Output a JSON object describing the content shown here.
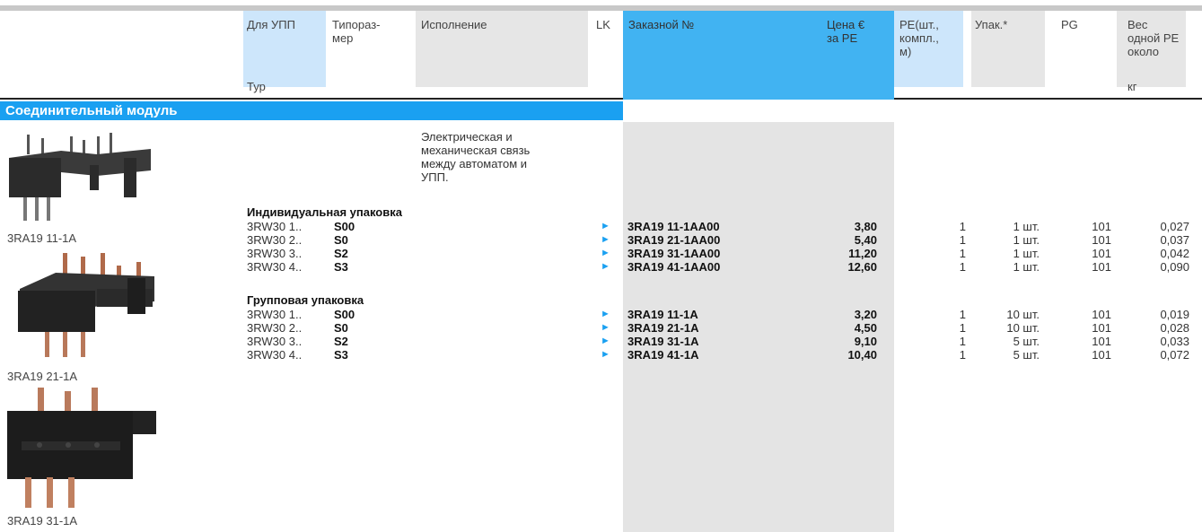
{
  "headers": {
    "dlya_upp": "Для УПП",
    "typ": "Тур",
    "tiporazmer_1": "Типораз-",
    "tiporazmer_2": "мер",
    "ispolnenie": "Исполнение",
    "lk": "LK",
    "order_no": "Заказной №",
    "price_1": "Цена €",
    "price_2": "за PE",
    "pe_1": "PE(шт.,",
    "pe_2": "компл.,",
    "pe_3": "м)",
    "upak": "Упак.*",
    "pg": "PG",
    "weight_1": "Вес",
    "weight_2": "одной PE",
    "weight_3": "около",
    "weight_unit": "кг"
  },
  "section_title": "Соединительный модуль",
  "description": [
    "Электрическая и",
    "механическая связь",
    "между автоматом и",
    "УПП."
  ],
  "group_individual": "Индивидуальная упаковка",
  "group_bulk": "Групповая упаковка",
  "rows_individual": [
    {
      "type": "3RW30 1..",
      "size": "S00",
      "lk": "►",
      "order": "3RA19 11-1AA00",
      "price": "3,80",
      "pe": "1",
      "pack": "1 шт.",
      "pg": "101",
      "weight": "0,027"
    },
    {
      "type": "3RW30 2..",
      "size": "S0",
      "lk": "►",
      "order": "3RA19 21-1AA00",
      "price": "5,40",
      "pe": "1",
      "pack": "1 шт.",
      "pg": "101",
      "weight": "0,037"
    },
    {
      "type": "3RW30 3..",
      "size": "S2",
      "lk": "►",
      "order": "3RA19 31-1AA00",
      "price": "11,20",
      "pe": "1",
      "pack": "1 шт.",
      "pg": "101",
      "weight": "0,042"
    },
    {
      "type": "3RW30 4..",
      "size": "S3",
      "lk": "►",
      "order": "3RA19 41-1AA00",
      "price": "12,60",
      "pe": "1",
      "pack": "1 шт.",
      "pg": "101",
      "weight": "0,090"
    }
  ],
  "rows_bulk": [
    {
      "type": "3RW30 1..",
      "size": "S00",
      "lk": "►",
      "order": "3RA19 11-1A",
      "price": "3,20",
      "pe": "1",
      "pack": "10 шт.",
      "pg": "101",
      "weight": "0,019"
    },
    {
      "type": "3RW30 2..",
      "size": "S0",
      "lk": "►",
      "order": "3RA19 21-1A",
      "price": "4,50",
      "pe": "1",
      "pack": "10 шт.",
      "pg": "101",
      "weight": "0,028"
    },
    {
      "type": "3RW30 3..",
      "size": "S2",
      "lk": "►",
      "order": "3RA19 31-1A",
      "price": "9,10",
      "pe": "1",
      "pack": "5 шт.",
      "pg": "101",
      "weight": "0,033"
    },
    {
      "type": "3RW30 4..",
      "size": "S3",
      "lk": "►",
      "order": "3RA19 41-1A",
      "price": "10,40",
      "pe": "1",
      "pack": "5 шт.",
      "pg": "101",
      "weight": "0,072"
    }
  ],
  "images": [
    {
      "label": "3RA19 11-1A"
    },
    {
      "label": "3RA19 21-1A"
    },
    {
      "label": "3RA19 31-1A"
    }
  ]
}
